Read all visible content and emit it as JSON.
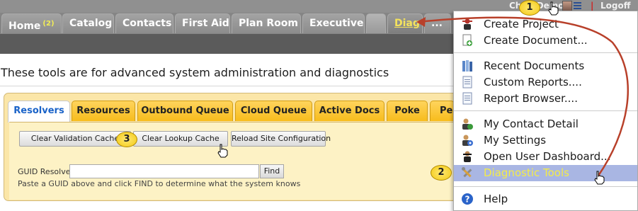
{
  "topbar": {
    "user_name": "Chris Demo",
    "separator": "|",
    "logoff": "Logoff"
  },
  "nav": {
    "tabs": [
      {
        "label": "Home",
        "badge": "(2)"
      },
      {
        "label": "Catalog"
      },
      {
        "label": "Contacts"
      },
      {
        "label": "First Aid"
      },
      {
        "label": "Plan Room"
      },
      {
        "label": "Executive"
      },
      {
        "label": ""
      },
      {
        "label": "Diag",
        "active": true
      },
      {
        "label": "..."
      }
    ]
  },
  "page": {
    "intro": "These tools are for advanced system administration and diagnostics"
  },
  "diag_tabs": [
    "Resolvers",
    "Resources",
    "Outbound Queue",
    "Cloud Queue",
    "Active Docs",
    "Poke",
    "Pe"
  ],
  "resolvers": {
    "buttons": [
      "Clear Validation Cache",
      "Clear Lookup Cache",
      "Reload Site Configuration"
    ],
    "guid_label": "GUID Resolver:",
    "guid_value": "",
    "find_label": "Find",
    "help_text": "Paste a GUID above and click FIND to determine what the system knows"
  },
  "user_menu": {
    "groups": [
      [
        {
          "label": "Create Project",
          "icon": "worker-icon"
        },
        {
          "label": "Create Document...",
          "icon": "new-document-icon"
        }
      ],
      [
        {
          "label": "Recent Documents",
          "icon": "books-icon"
        },
        {
          "label": "Custom Reports....",
          "icon": "report-icon"
        },
        {
          "label": "Report Browser....",
          "icon": "report-browser-icon"
        }
      ],
      [
        {
          "label": "My Contact Detail",
          "icon": "contact-icon"
        },
        {
          "label": "My Settings",
          "icon": "user-settings-icon"
        },
        {
          "label": "Open User Dashboard...",
          "icon": "dashboard-user-icon"
        },
        {
          "label": "Diagnostic Tools",
          "icon": "tools-icon",
          "highlighted": true
        }
      ],
      [
        {
          "label": "Help",
          "icon": "help-icon"
        }
      ]
    ]
  },
  "annotations": {
    "callouts": [
      "1",
      "2",
      "3"
    ],
    "arrow_color": "#b8402a",
    "callout_color": "#f5cf1c"
  },
  "colors": {
    "diag_tab_active_text": "#f5e35c",
    "menu_highlight": "#a9b6e3",
    "panel_tab": "#f9c42a",
    "panel_bg": "#fbe6a8",
    "resolvers_tab_text": "#1a63c8"
  }
}
